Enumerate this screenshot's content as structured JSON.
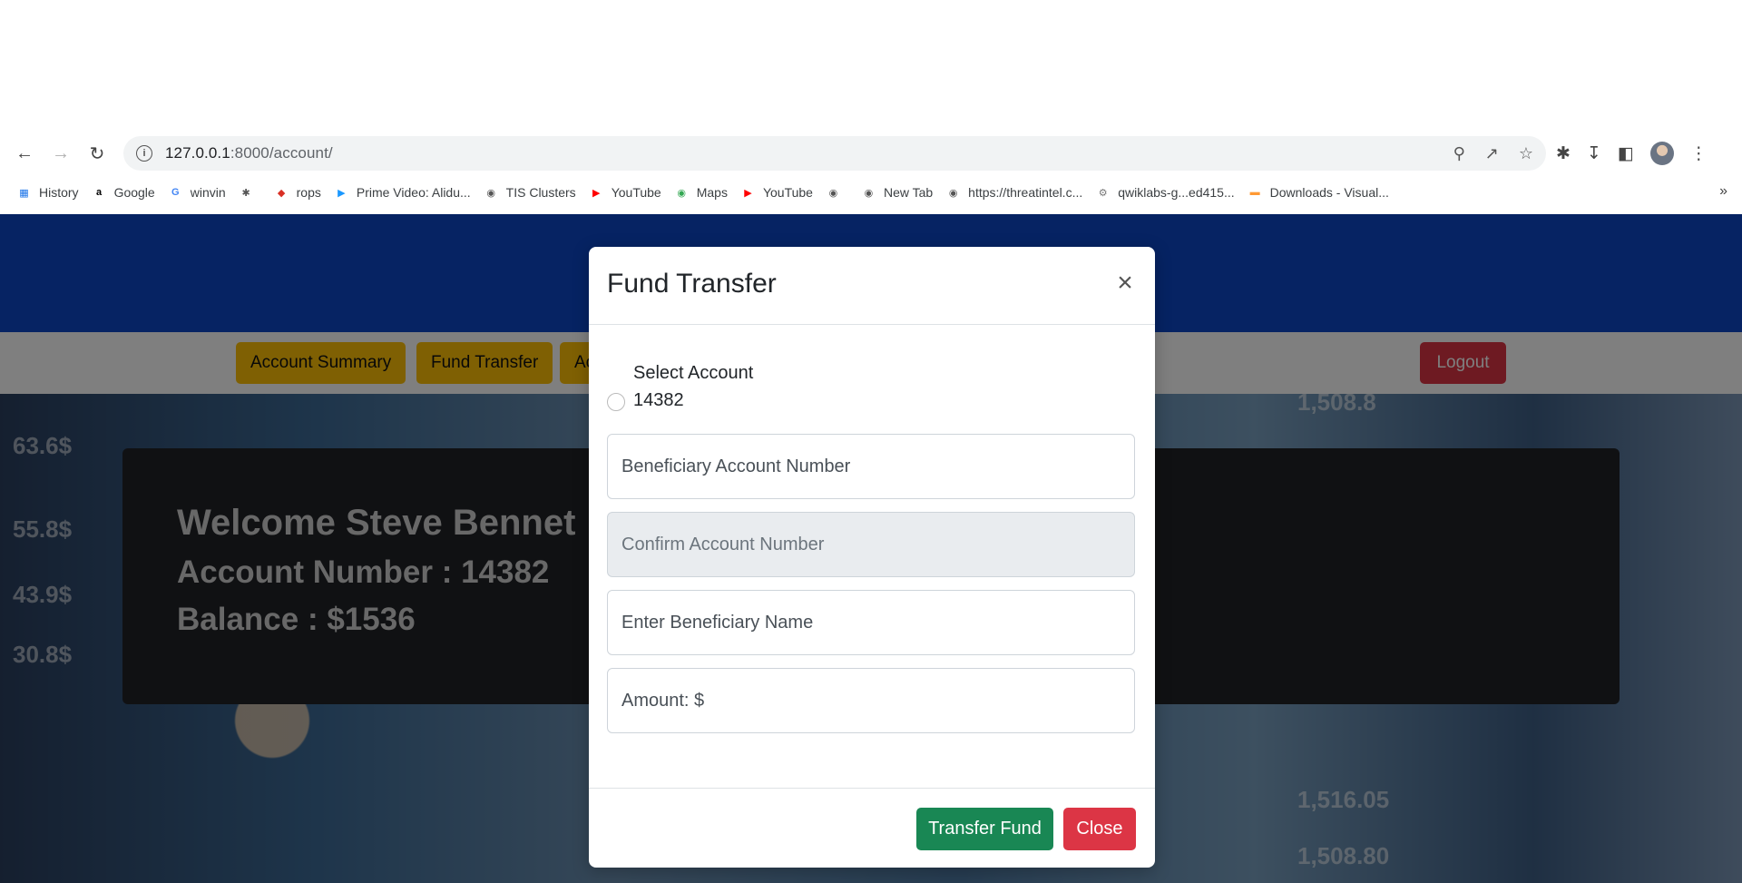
{
  "browser": {
    "url_host": "127.0.0.1",
    "url_path": ":8000/account/",
    "bookmarks": [
      {
        "label": "History",
        "icon": "google-sheets-icon",
        "color": "#1a73e8"
      },
      {
        "label": "Google",
        "icon": "amazon-icon",
        "color": "#000000"
      },
      {
        "label": "winvin",
        "icon": "google-icon",
        "color": "#4285f4"
      },
      {
        "label": "",
        "icon": "puzzle-icon",
        "color": "#555555"
      },
      {
        "label": "rops",
        "icon": "rops-icon",
        "color": "#d93025"
      },
      {
        "label": "Prime Video: Alidu...",
        "icon": "prime-video-icon",
        "color": "#1a98ff"
      },
      {
        "label": "TIS Clusters",
        "icon": "globe-icon",
        "color": "#555555"
      },
      {
        "label": "YouTube",
        "icon": "youtube-icon",
        "color": "#ff0000"
      },
      {
        "label": "Maps",
        "icon": "maps-icon",
        "color": "#34a853"
      },
      {
        "label": "YouTube",
        "icon": "youtube-icon",
        "color": "#ff0000"
      },
      {
        "label": "",
        "icon": "globe-icon",
        "color": "#555555"
      },
      {
        "label": "New Tab",
        "icon": "globe-icon",
        "color": "#555555"
      },
      {
        "label": "https://threatintel.c...",
        "icon": "globe-icon",
        "color": "#555555"
      },
      {
        "label": "qwiklabs-g...ed415...",
        "icon": "gear-icon",
        "color": "#777777"
      },
      {
        "label": "Downloads - Visual...",
        "icon": "india-flag-icon",
        "color": "#ff9933"
      }
    ]
  },
  "nav": {
    "account_summary": "Account Summary",
    "fund_transfer": "Fund Transfer",
    "third": "Ac",
    "logout": "Logout"
  },
  "welcome": {
    "greeting": "Welcome Steve Bennet",
    "account_number": "Account Number : 14382",
    "balance": "Balance : $1536"
  },
  "background_numbers": [
    "63.6$",
    "55.8$",
    "43.9$",
    "30.8$",
    "1,516.05",
    "1,508.80",
    "1,508.8"
  ],
  "modal": {
    "title": "Fund Transfer",
    "close_icon": "×",
    "select_account_label": "Select Account",
    "account_option": "14382",
    "beneficiary_placeholder": "Beneficiary Account Number",
    "confirm_placeholder": "Confirm Account Number",
    "name_placeholder": "Enter Beneficiary Name",
    "amount_placeholder": "Amount: $",
    "transfer_button": "Transfer Fund",
    "close_button": "Close"
  },
  "colors": {
    "header_blue": "#0d47c7",
    "nav_yellow": "#ffc107",
    "logout_red": "#dc3545",
    "transfer_green": "#198754"
  }
}
